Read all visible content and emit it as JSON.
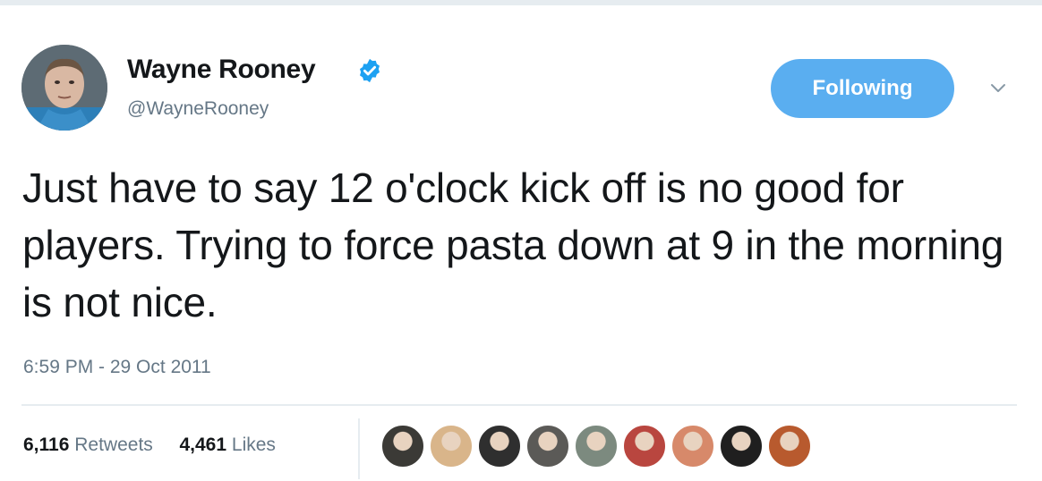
{
  "tweet": {
    "display_name": "Wayne Rooney",
    "handle": "@WayneRooney",
    "follow_button_label": "Following",
    "text": "Just have to say 12 o'clock kick off is no good for players. Trying to force pasta down at 9 in the morning is not nice.",
    "timestamp": "6:59 PM - 29 Oct 2011",
    "retweets_count": "6,116",
    "retweets_label": "Retweets",
    "likes_count": "4,461",
    "likes_label": "Likes"
  },
  "icons": {
    "verified": "verified-badge-icon",
    "menu": "chevron-down-icon"
  },
  "likers": [
    {
      "color": "#3b3a36"
    },
    {
      "color": "#d9b58a"
    },
    {
      "color": "#2f2f2f"
    },
    {
      "color": "#5b5a57"
    },
    {
      "color": "#7c8a7f"
    },
    {
      "color": "#b9463f"
    },
    {
      "color": "#d7896a"
    },
    {
      "color": "#1f1f1f"
    },
    {
      "color": "#b85a2e"
    }
  ],
  "colors": {
    "accent": "#5aaef0",
    "secondary_text": "#657786",
    "primary_text": "#14171a",
    "divider": "#e6ecf0"
  }
}
